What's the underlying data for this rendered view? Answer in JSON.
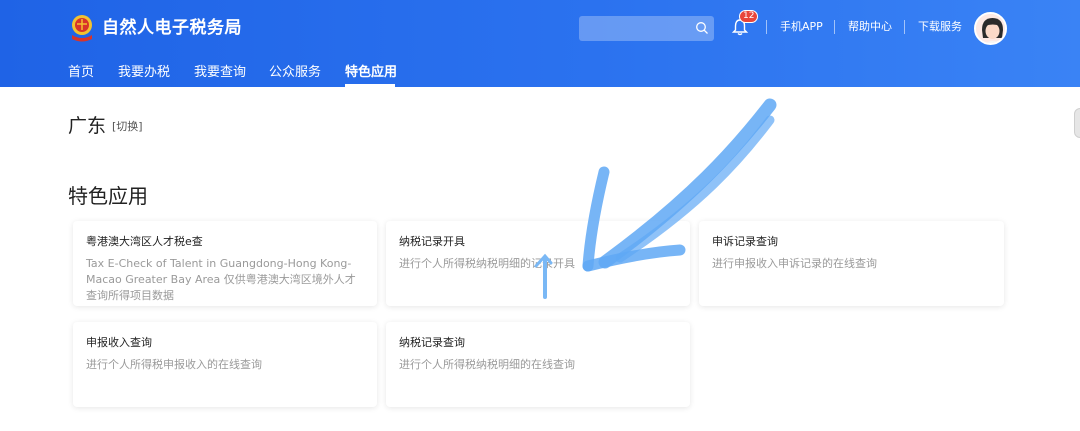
{
  "header": {
    "brand": "自然人电子税务局",
    "search": {
      "placeholder": ""
    },
    "notification_count": "12",
    "links": {
      "mobile_app": "手机APP",
      "help_center": "帮助中心",
      "download": "下载服务"
    }
  },
  "nav": {
    "items": [
      {
        "label": "首页"
      },
      {
        "label": "我要办税"
      },
      {
        "label": "我要查询"
      },
      {
        "label": "公众服务"
      },
      {
        "label": "特色应用"
      }
    ],
    "active": "特色应用"
  },
  "region": {
    "name": "广东",
    "switch_label": "[切换]"
  },
  "section": {
    "title": "特色应用"
  },
  "cards": [
    {
      "title": "粤港澳大湾区人才税e查",
      "desc": "Tax E-Check of Talent in Guangdong-Hong Kong-Macao Greater Bay Area 仅供粤港澳大湾区境外人才查询所得项目数据"
    },
    {
      "title": "纳税记录开具",
      "desc": "进行个人所得税纳税明细的记录开具"
    },
    {
      "title": "申诉记录查询",
      "desc": "进行申报收入申诉记录的在线查询"
    },
    {
      "title": "申报收入查询",
      "desc": "进行个人所得税申报收入的在线查询"
    },
    {
      "title": "纳税记录查询",
      "desc": "进行个人所得税纳税明细的在线查询"
    }
  ],
  "colors": {
    "header_blue": "#2468eb",
    "annotation_blue": "#5fa8f5",
    "badge_red": "#e8463b"
  },
  "icons": {
    "logo": "tax-emblem-icon",
    "search": "search-icon",
    "bell": "bell-icon",
    "avatar": "user-avatar"
  }
}
